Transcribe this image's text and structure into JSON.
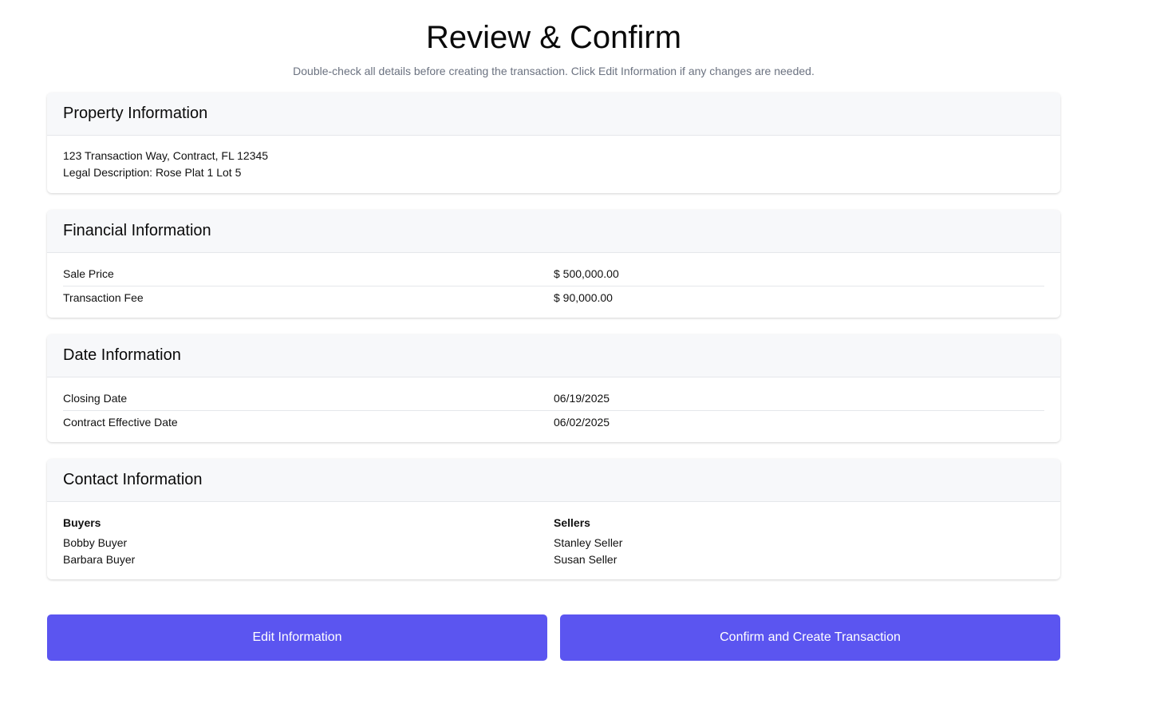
{
  "header": {
    "title": "Review & Confirm",
    "subtitle": "Double-check all details before creating the transaction. Click Edit Information if any changes are needed."
  },
  "property": {
    "heading": "Property Information",
    "address": "123 Transaction Way, Contract, FL 12345",
    "legal_description": "Legal Description: Rose Plat 1 Lot 5"
  },
  "financial": {
    "heading": "Financial Information",
    "rows": [
      {
        "label": "Sale Price",
        "value": "$ 500,000.00"
      },
      {
        "label": "Transaction Fee",
        "value": "$ 90,000.00"
      }
    ]
  },
  "dates": {
    "heading": "Date Information",
    "rows": [
      {
        "label": "Closing Date",
        "value": "06/19/2025"
      },
      {
        "label": "Contract Effective Date",
        "value": "06/02/2025"
      }
    ]
  },
  "contacts": {
    "heading": "Contact Information",
    "buyers": {
      "label": "Buyers",
      "names": [
        "Bobby Buyer",
        "Barbara Buyer"
      ]
    },
    "sellers": {
      "label": "Sellers",
      "names": [
        "Stanley Seller",
        "Susan Seller"
      ]
    }
  },
  "actions": {
    "edit_label": "Edit Information",
    "confirm_label": "Confirm and Create Transaction"
  },
  "colors": {
    "button_bg": "#5b55f0",
    "card_header_bg": "#f7f8fa",
    "subtitle_text": "#6b7280"
  }
}
